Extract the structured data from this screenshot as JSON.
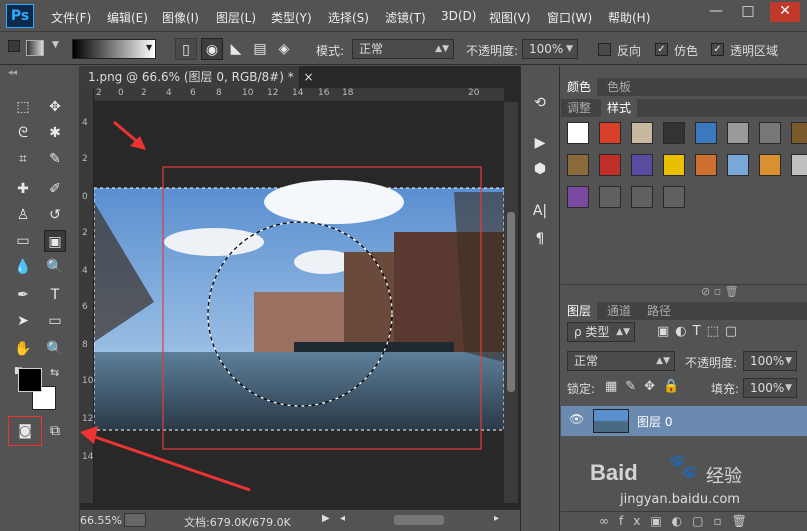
{
  "menubar": {
    "logo": "Ps",
    "items": [
      "文件(F)",
      "编辑(E)",
      "图像(I)",
      "图层(L)",
      "类型(Y)",
      "选择(S)",
      "滤镜(T)",
      "3D(D)",
      "视图(V)",
      "窗口(W)",
      "帮助(H)"
    ],
    "window_controls": [
      "—",
      "□",
      "✕"
    ]
  },
  "options": {
    "mode_label": "模式:",
    "mode_value": "正常",
    "opacity_label": "不透明度:",
    "opacity_value": "100%",
    "reverse_label": "反向",
    "dither_label": "仿色",
    "transparency_label": "透明区域",
    "dither_checked": true,
    "transparency_checked": true,
    "reverse_checked": false
  },
  "document": {
    "tab_title": "1.png @ 66.6% (图层 0, RGB/8#) *",
    "tab_close": "×",
    "zoom": "66.55%",
    "doc_info": "文档:679.0K/679.0K",
    "ruler_top": [
      "2",
      "0",
      "2",
      "4",
      "6",
      "8",
      "10",
      "12",
      "14",
      "16",
      "18",
      "20"
    ],
    "ruler_left": [
      "4",
      "2",
      "0",
      "2",
      "4",
      "6",
      "8",
      "10",
      "12",
      "14"
    ]
  },
  "color_panel": {
    "tabs": [
      "颜色",
      "色板"
    ],
    "tabs2": [
      "调整",
      "样式"
    ],
    "swatch_colors": [
      "#ffffff",
      "#d8402a",
      "#c9b8a0",
      "#333333",
      "#3a78c0",
      "#9a9a9a",
      "#777777",
      "#7a5a2a",
      "#8a6a3a",
      "#c0302a",
      "#5a4aa0",
      "#e8c000",
      "#d07030",
      "#78a8d8",
      "#d89030",
      "#c0c0c0",
      "#7a4aa0",
      "#606060",
      "#606060",
      "#606060"
    ]
  },
  "layers_panel": {
    "tabs": [
      "图层",
      "通道",
      "路径"
    ],
    "kind_label": "ρ 类型",
    "blend_mode": "正常",
    "opacity_label": "不透明度:",
    "opacity_value": "100%",
    "lock_label": "锁定:",
    "fill_label": "填充:",
    "fill_value": "100%",
    "layer_name": "图层 0"
  },
  "watermark": {
    "text1": "Baid",
    "text2": "经验",
    "text3": "jingyan.baidu.com"
  }
}
